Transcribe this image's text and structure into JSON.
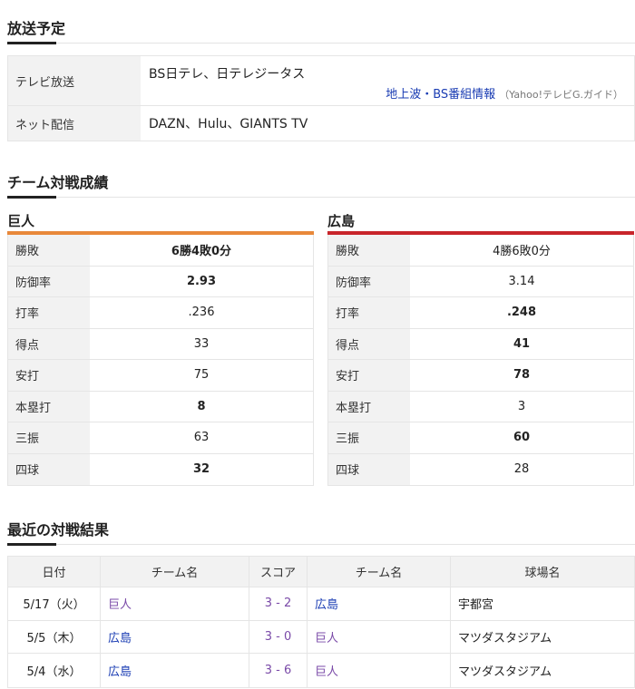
{
  "broadcast": {
    "heading": "放送予定",
    "tv_label": "テレビ放送",
    "tv_value": "BS日テレ、日テレジータス",
    "tv_link": "地上波・BS番組情報",
    "tv_link_source": "（Yahoo!テレビG.ガイド）",
    "net_label": "ネット配信",
    "net_value": "DAZN、Hulu、GIANTS TV"
  },
  "matchup": {
    "heading": "チーム対戦成績",
    "home": {
      "name": "巨人",
      "color": "#e8883a",
      "rows": [
        {
          "label": "勝敗",
          "value": "6勝4敗0分",
          "bold": true
        },
        {
          "label": "防御率",
          "value": "2.93",
          "bold": true
        },
        {
          "label": "打率",
          "value": ".236",
          "bold": false
        },
        {
          "label": "得点",
          "value": "33",
          "bold": false
        },
        {
          "label": "安打",
          "value": "75",
          "bold": false
        },
        {
          "label": "本塁打",
          "value": "8",
          "bold": true
        },
        {
          "label": "三振",
          "value": "63",
          "bold": false
        },
        {
          "label": "四球",
          "value": "32",
          "bold": true
        }
      ]
    },
    "away": {
      "name": "広島",
      "color": "#c8252b",
      "rows": [
        {
          "label": "勝敗",
          "value": "4勝6敗0分",
          "bold": false
        },
        {
          "label": "防御率",
          "value": "3.14",
          "bold": false
        },
        {
          "label": "打率",
          "value": ".248",
          "bold": true
        },
        {
          "label": "得点",
          "value": "41",
          "bold": true
        },
        {
          "label": "安打",
          "value": "78",
          "bold": true
        },
        {
          "label": "本塁打",
          "value": "3",
          "bold": false
        },
        {
          "label": "三振",
          "value": "60",
          "bold": true
        },
        {
          "label": "四球",
          "value": "28",
          "bold": false
        }
      ]
    }
  },
  "results": {
    "heading": "最近の対戦結果",
    "columns": [
      "日付",
      "チーム名",
      "スコア",
      "チーム名",
      "球場名"
    ],
    "rows": [
      {
        "date": "5/17（火）",
        "team1": "巨人",
        "team1_visited": true,
        "score": "3 - 2",
        "team2": "広島",
        "team2_visited": false,
        "stadium": "宇都宮"
      },
      {
        "date": "5/5（木）",
        "team1": "広島",
        "team1_visited": false,
        "score": "3 - 0",
        "team2": "巨人",
        "team2_visited": true,
        "stadium": "マツダスタジアム"
      },
      {
        "date": "5/4（水）",
        "team1": "広島",
        "team1_visited": false,
        "score": "3 - 6",
        "team2": "巨人",
        "team2_visited": true,
        "stadium": "マツダスタジアム"
      }
    ]
  }
}
